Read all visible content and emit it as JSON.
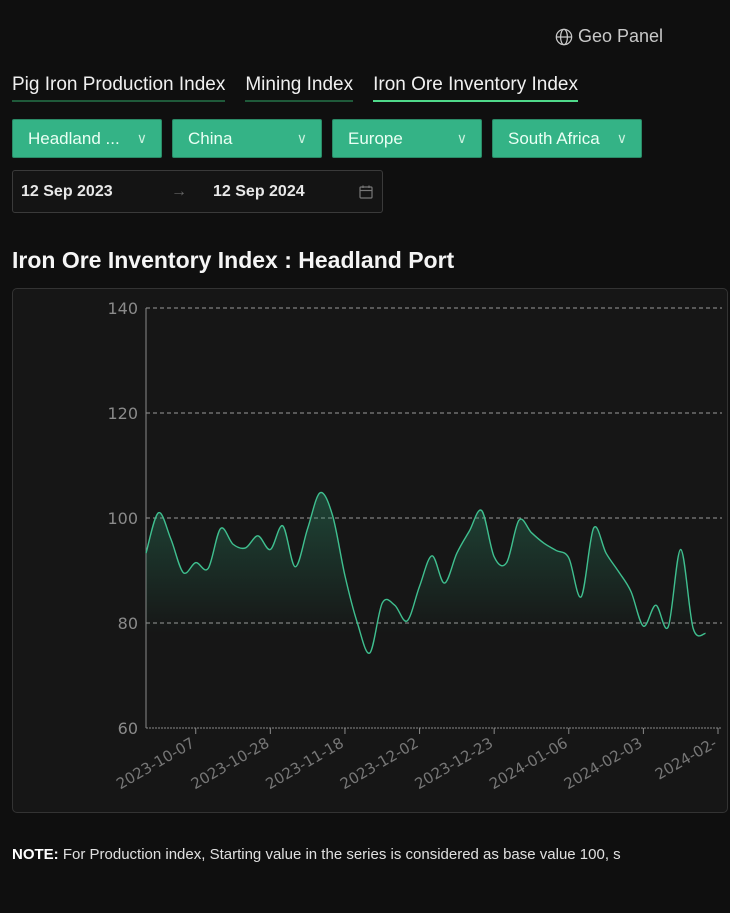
{
  "header": {
    "geo_panel_label": "Geo Panel",
    "geo_icon": "globe-icon"
  },
  "tabs": [
    {
      "label": "Pig Iron Production Index",
      "active": false
    },
    {
      "label": "Mining Index",
      "active": false
    },
    {
      "label": "Iron Ore Inventory Index",
      "active": true
    }
  ],
  "filters": [
    {
      "value": "Headland ..."
    },
    {
      "value": "China"
    },
    {
      "value": "Europe"
    },
    {
      "value": "South Africa"
    }
  ],
  "date_range": {
    "start": "12 Sep 2023",
    "arrow": "→",
    "end": "12 Sep 2024",
    "icon": "calendar-icon"
  },
  "chart_title": "Iron Ore Inventory Index : Headland Port",
  "note": {
    "label": "NOTE:",
    "text": " For Production index, Starting value in the series is considered as base value 100, s"
  },
  "colors": {
    "accent": "#34b386",
    "line": "#3fbf8f",
    "background": "#0f0f0f",
    "card": "#161616"
  },
  "chart_data": {
    "type": "area",
    "title": "Iron Ore Inventory Index : Headland Port",
    "ylim": [
      60,
      140
    ],
    "yticks": [
      60,
      80,
      100,
      120,
      140
    ],
    "grid": "horizontal dashed",
    "x_ticks": [
      {
        "index": 4,
        "label": "2023-10-07"
      },
      {
        "index": 10,
        "label": "2023-10-28"
      },
      {
        "index": 16,
        "label": "2023-11-18"
      },
      {
        "index": 22,
        "label": "2023-12-02"
      },
      {
        "index": 28,
        "label": "2023-12-23"
      },
      {
        "index": 34,
        "label": "2024-01-06"
      },
      {
        "index": 40,
        "label": "2024-02-03"
      },
      {
        "index": 46,
        "label": "2024-02-"
      }
    ],
    "values": [
      93.3,
      101,
      96,
      89.6,
      91.5,
      90.4,
      98,
      95,
      94.3,
      96.6,
      94,
      98.5,
      90.7,
      98,
      104.8,
      100.5,
      89,
      80,
      74.3,
      83.8,
      83.4,
      80.4,
      87,
      92.8,
      87.6,
      93.3,
      97.5,
      101.4,
      92.6,
      91.5,
      99.6,
      97.2,
      95.2,
      93.8,
      92.4,
      85,
      98.1,
      93.3,
      89.8,
      86,
      79.4,
      83.4,
      79.3,
      94,
      79,
      78
    ]
  }
}
